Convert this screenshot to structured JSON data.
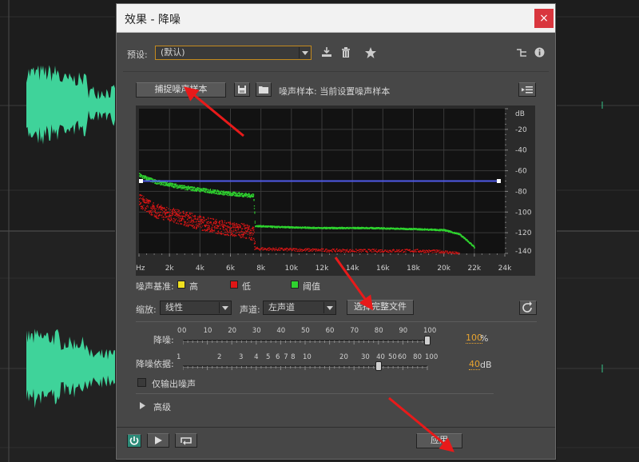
{
  "dialog": {
    "title": "效果 - 降噪",
    "close_glyph": "×"
  },
  "preset": {
    "label": "预设:",
    "value": "(默认)",
    "icons": [
      "import-icon",
      "trash-icon",
      "star-icon",
      "routing-icon",
      "info-icon"
    ]
  },
  "capture": {
    "button_label": "捕捉噪声样本",
    "noise_sample_label": "噪声样本: 当前设置噪声样本"
  },
  "chart_data": {
    "type": "scatter",
    "title": "",
    "xlabel": "",
    "ylabel": "dB",
    "x_unit": "Hz",
    "x_ticks": [
      "Hz",
      "2k",
      "4k",
      "6k",
      "8k",
      "10k",
      "12k",
      "14k",
      "16k",
      "18k",
      "20k",
      "22k",
      "24k"
    ],
    "y_ticks": [
      "dB",
      "-20",
      "-40",
      "-60",
      "-80",
      "-100",
      "-120",
      "-140"
    ],
    "xlim": [
      0,
      24000
    ],
    "ylim": [
      -140,
      0
    ],
    "grid": true,
    "series": [
      {
        "name": "阈值",
        "color": "#2fd32f",
        "x": [
          0,
          1000,
          2000,
          3000,
          4000,
          5000,
          6000,
          7000,
          7500,
          7600,
          9000,
          12000,
          15000,
          18000,
          20000,
          21000,
          21500,
          22000
        ],
        "y": [
          -64,
          -70,
          -73,
          -76,
          -78,
          -80,
          -82,
          -83,
          -84,
          -113,
          -114,
          -115,
          -115,
          -116,
          -117,
          -121,
          -127,
          -134
        ]
      },
      {
        "name": "低",
        "color": "#e01616",
        "x": [
          0,
          1000,
          2000,
          3000,
          4000,
          5000,
          6000,
          7000,
          7500,
          7600,
          10000,
          14000,
          18000,
          20000,
          21000
        ],
        "y": [
          -88,
          -98,
          -102,
          -106,
          -110,
          -113,
          -116,
          -118,
          -121,
          -135,
          -136,
          -137,
          -137,
          -138,
          -140
        ]
      },
      {
        "name": "高",
        "color": "#f0e020",
        "x": [],
        "y": []
      }
    ],
    "noise_floor_line": {
      "color": "#4f5ae8",
      "y": -70
    }
  },
  "legend": {
    "label": "噪声基准:",
    "items": [
      {
        "name": "高",
        "color": "#f0e020"
      },
      {
        "name": "低",
        "color": "#e01616"
      },
      {
        "name": "阈值",
        "color": "#2fd32f"
      }
    ]
  },
  "scale": {
    "label": "缩放:",
    "value": "线性",
    "channel_label": "声道:",
    "channel_value": "左声道",
    "select_button": "选择完整文件"
  },
  "reduction": {
    "label": "降噪:",
    "ticks": [
      "0",
      "0",
      "10",
      "20",
      "30",
      "40",
      "50",
      "60",
      "70",
      "80",
      "90",
      "100"
    ],
    "value": "100",
    "unit": "%",
    "level": 1.0
  },
  "reduce_by": {
    "label": "降噪依据:",
    "ticks": [
      "1",
      "2",
      "3",
      "4",
      "5",
      "6",
      "7",
      "8",
      "10",
      "20",
      "30",
      "40",
      "50",
      "60",
      "80",
      "100"
    ],
    "value": "40",
    "unit": "dB",
    "level": 0.8
  },
  "output_noise_only": {
    "label": "仅输出噪声",
    "checked": false
  },
  "advanced": {
    "label": "高级"
  },
  "footer": {
    "apply_label": "应用",
    "icons": [
      "power-icon",
      "play-icon",
      "loop-icon"
    ]
  }
}
